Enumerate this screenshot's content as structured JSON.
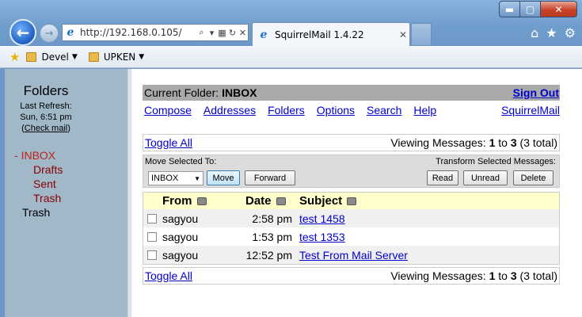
{
  "browser": {
    "address": "http://192.168.0.105/",
    "tab_title": "SquirrelMail 1.4.22",
    "window_buttons": {
      "min": "▬",
      "max": "▢",
      "close": "✕"
    },
    "favorites": [
      "Devel",
      "UPKEN"
    ]
  },
  "sidebar": {
    "title": "Folders",
    "last_refresh_label": "Last Refresh:",
    "last_refresh_time": "Sun, 6:51 pm",
    "check_mail": "Check mail",
    "folders": [
      {
        "prefix": "- ",
        "label": "INBOX"
      },
      {
        "prefix": "",
        "label": "Drafts"
      },
      {
        "prefix": "",
        "label": "Sent"
      },
      {
        "prefix": "",
        "label": "Trash"
      },
      {
        "prefix": "",
        "label": "Trash"
      }
    ]
  },
  "header": {
    "current_folder_label": "Current Folder:",
    "current_folder": "INBOX",
    "sign_out": "Sign Out"
  },
  "menu": {
    "compose": "Compose",
    "addresses": "Addresses",
    "folders": "Folders",
    "options": "Options",
    "search": "Search",
    "help": "Help",
    "brand": "SquirrelMail"
  },
  "nav": {
    "toggle_all": "Toggle All",
    "viewing_label": "Viewing Messages:",
    "from": "1",
    "to_word": "to",
    "to": "3",
    "total": "(3 total)"
  },
  "actions": {
    "move_label": "Move Selected To:",
    "transform_label": "Transform Selected Messages:",
    "selected_folder": "INBOX",
    "move": "Move",
    "forward": "Forward",
    "read": "Read",
    "unread": "Unread",
    "delete": "Delete"
  },
  "table": {
    "headers": {
      "from": "From",
      "date": "Date",
      "subject": "Subject"
    },
    "rows": [
      {
        "from": "sagyou",
        "date": "2:58 pm",
        "subject": "test 1458"
      },
      {
        "from": "sagyou",
        "date": "1:53 pm",
        "subject": "test 1353"
      },
      {
        "from": "sagyou",
        "date": "12:52 pm",
        "subject": "Test From Mail Server"
      }
    ]
  }
}
